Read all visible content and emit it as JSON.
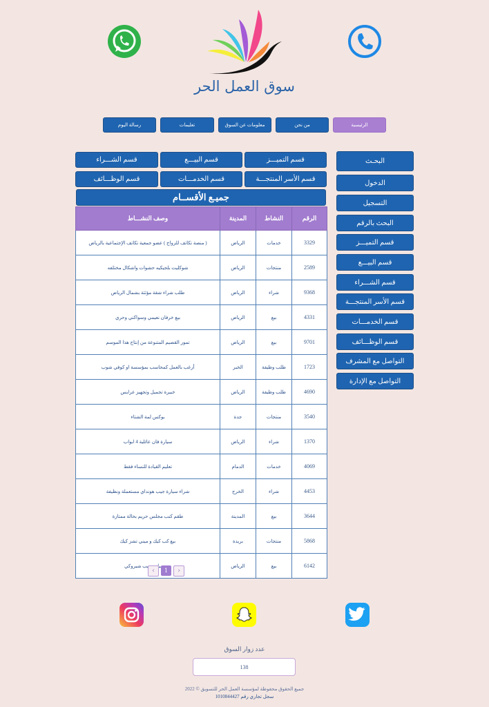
{
  "brand": {
    "title": "سوق العمل الحر"
  },
  "nav": [
    {
      "label": "الرئيسية",
      "active": true
    },
    {
      "label": "من نحن"
    },
    {
      "label": "معلومات عن السوق"
    },
    {
      "label": "تعليمات"
    },
    {
      "label": "رسالة اليوم"
    }
  ],
  "categories": [
    {
      "label": "قسم التميـــز"
    },
    {
      "label": "قسم البيـــع"
    },
    {
      "label": "قسم الشـــراء"
    },
    {
      "label": "قسم الأسر المنتجـــة"
    },
    {
      "label": "قسم الخدمـــات"
    },
    {
      "label": "قسم الوظـــائف"
    }
  ],
  "all_sections": "جميـع الأقســام",
  "sidebar": [
    {
      "label": "البحـث"
    },
    {
      "label": "الدخول"
    },
    {
      "label": "التسجيل"
    },
    {
      "label": "البحث بالرقم"
    },
    {
      "label": "قسم التميـــز"
    },
    {
      "label": "قسم البيـــع"
    },
    {
      "label": "قسم الشـــراء"
    },
    {
      "label": "قسم الأسر المنتجـــة"
    },
    {
      "label": "قسم الخدمـــات"
    },
    {
      "label": "قسم الوظـــائف"
    },
    {
      "label": "التواصل مع المشرف"
    },
    {
      "label": "التواصل مع الإدارة"
    }
  ],
  "table": {
    "headers": [
      "الرقم",
      "النشاط",
      "المدينة",
      "وصف النشـــاط"
    ],
    "rows": [
      [
        "3329",
        "خدمات",
        "الرياض",
        "( منصة تكاتف للزواج ) عضو جمعية تكاتف الإجتماعية بالرياض"
      ],
      [
        "2589",
        "منتجات",
        "الرياض",
        "شوكليت بلجيكيه حشوات واشكال مختلفه"
      ],
      [
        "9368",
        "شراء",
        "الرياض",
        "طلب شراء شقة مؤثثة بشمال الرياض"
      ],
      [
        "4331",
        "بيع",
        "الرياض",
        "بيع خرفان نعيمي وسواكني وحري"
      ],
      [
        "9701",
        "بيع",
        "الرياض",
        "تمور القصيم المتنوعة من إنتاج هذا الموسم"
      ],
      [
        "1723",
        "طلب وظيفة",
        "الخبر",
        "أرغب بالعمل كمحاسب بمؤسسة او كوفي شوب"
      ],
      [
        "4690",
        "طلب وظيفة",
        "الرياض",
        "خبيرة تجميل وتجهيز عرايس"
      ],
      [
        "3540",
        "منتجات",
        "جدة",
        "بوكس لمة الشتاء"
      ],
      [
        "1370",
        "شراء",
        "الرياض",
        "سيارة فان عائلية 4 ابواب"
      ],
      [
        "4069",
        "خدمات",
        "الدمام",
        "تعليم القيادة للنساء فقط"
      ],
      [
        "4453",
        "شراء",
        "الخرج",
        "شراء سيارة جيب هونداي مستعملة ونظيفة"
      ],
      [
        "3644",
        "بيع",
        "المدينة",
        "طقم كنب مجلس حريم بحالة ممتازة"
      ],
      [
        "5868",
        "منتجات",
        "بريدة",
        "بيع كب كيك و ميني تشز كيك"
      ],
      [
        "6142",
        "بيع",
        "الرياض",
        "بيع سياره جيب شيروكي"
      ]
    ]
  },
  "pagination": {
    "prev": "‹",
    "current": "1",
    "next": "›"
  },
  "social": {
    "instagram": "instagram-icon",
    "snapchat": "snapchat-icon",
    "twitter": "twitter-icon",
    "whatsapp": "whatsapp-icon",
    "phone": "phone-icon"
  },
  "visitors": {
    "label": "عدد زوار السوق",
    "count": "138"
  },
  "footer": {
    "copyright": "جميع الحقوق محفوظة لمؤسسة العمل الحر للتسويق © 2022",
    "registry": "سجل تجاري رقم 1010844427"
  },
  "colors": {
    "background": "#f3e6e2",
    "button": "#1f64b0",
    "active": "#a97fd2",
    "header": "#a27ccf"
  }
}
